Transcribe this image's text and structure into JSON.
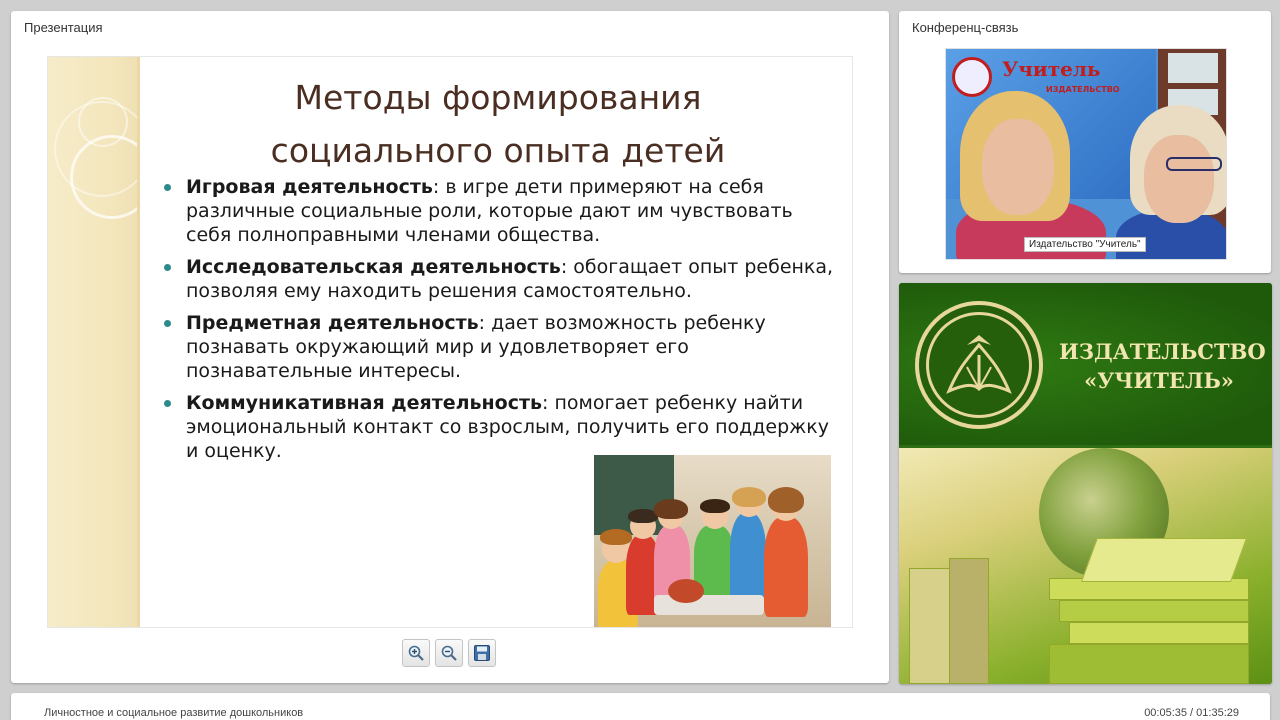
{
  "presentation": {
    "panel_title": "Презентация",
    "slide": {
      "title_line1": "Методы формирования",
      "title_line2": "социального опыта детей",
      "items": [
        {
          "bold": "Игровая деятельность",
          "text": ": в игре дети примеряют на себя различные социальные роли, которые дают им чувствовать себя полноправными членами общества."
        },
        {
          "bold": "Исследовательская деятельность",
          "text": ": обогащает опыт ребенка, позволяя ему находить решения самостоятельно."
        },
        {
          "bold": "Предметная деятельность",
          "text": ": дает возможность ребенку познавать окружающий мир и удовлетворяет его познавательные интересы."
        },
        {
          "bold": "Коммуникативная деятельность",
          "text": ": помогает ребенку найти эмоциональный контакт со взрослым, получить его поддержку и оценку."
        }
      ]
    },
    "tools": {
      "zoom_in": "zoom-in-icon",
      "zoom_out": "zoom-out-icon",
      "save": "save-icon"
    }
  },
  "conference": {
    "panel_title": "Конференц-связь",
    "video_caption": "Издательство \"Учитель\"",
    "banner_text": "Учитель",
    "banner_sub": "ИЗДАТЕЛЬСТВО"
  },
  "publisher": {
    "line1": "ИЗДАТЕЛЬСТВО",
    "line2": "«УЧИТЕЛЬ»"
  },
  "footer": {
    "course_title": "Личностное и социальное развитие дошкольников",
    "time": "00:05:35 / 01:35:29"
  },
  "colors": {
    "title": "#4a2e22",
    "bullet": "#2c8a8c",
    "publisher_green": "#2e6e14",
    "publisher_gold": "#f1e6b0"
  }
}
